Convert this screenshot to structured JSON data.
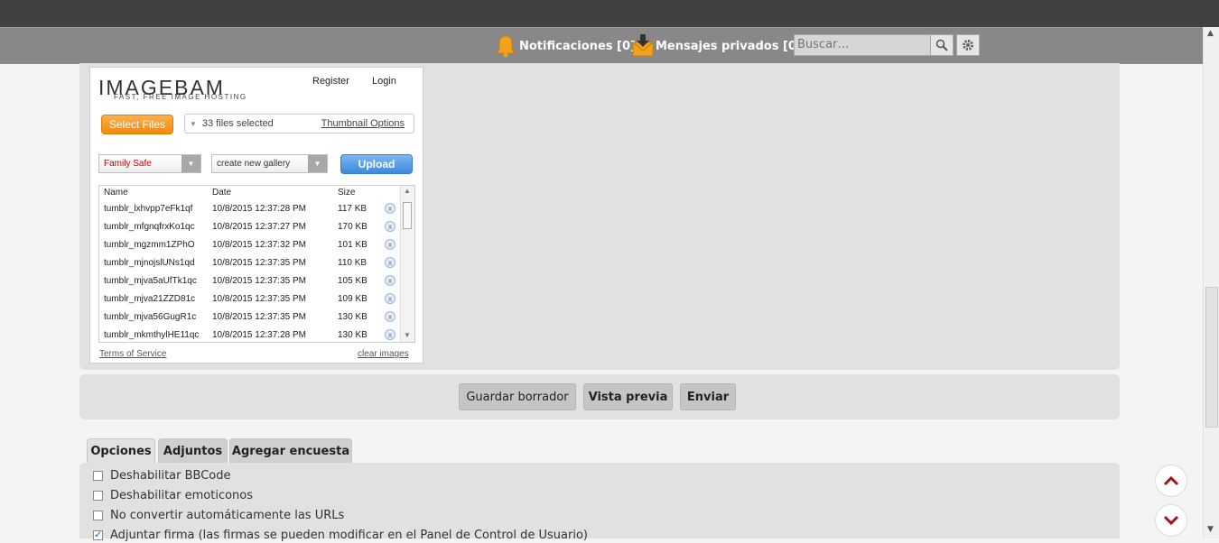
{
  "header": {
    "notifications_label": "Notificaciones [0]",
    "messages_label": "Mensajes privados [0]",
    "search_placeholder": "Buscar…",
    "icons": {
      "notifications": "bell-icon",
      "messages": "inbox-icon",
      "search": "search-icon",
      "advanced": "gear-icon"
    }
  },
  "uploader": {
    "logo": "IMAGEBAM",
    "tagline": "FAST, FREE IMAGE HOSTING",
    "register": "Register",
    "login": "Login",
    "select_files": "Select Files",
    "files_selected": "33 files selected",
    "thumbnail_options": "Thumbnail Options",
    "content_type": "Family Safe",
    "gallery": "create new gallery",
    "upload": "Upload",
    "columns": {
      "name": "Name",
      "date": "Date",
      "size": "Size"
    },
    "files": [
      {
        "name": "tumblr_lxhvpp7eFk1qf",
        "date": "10/8/2015 12:37:28 PM",
        "size": "117 KB"
      },
      {
        "name": "tumblr_mfgnqfrxKo1qc",
        "date": "10/8/2015 12:37:27 PM",
        "size": "170 KB"
      },
      {
        "name": "tumblr_mgzmm1ZPhO",
        "date": "10/8/2015 12:37:32 PM",
        "size": "101 KB"
      },
      {
        "name": "tumblr_mjnojslUNs1qd",
        "date": "10/8/2015 12:37:35 PM",
        "size": "110 KB"
      },
      {
        "name": "tumblr_mjva5aUfTk1qc",
        "date": "10/8/2015 12:37:35 PM",
        "size": "105 KB"
      },
      {
        "name": "tumblr_mjva21ZZD81c",
        "date": "10/8/2015 12:37:35 PM",
        "size": "109 KB"
      },
      {
        "name": "tumblr_mjva56GugR1c",
        "date": "10/8/2015 12:37:35 PM",
        "size": "130 KB"
      },
      {
        "name": "tumblr_mkmthylHE11qc",
        "date": "10/8/2015 12:37:28 PM",
        "size": "130 KB"
      }
    ],
    "remove_glyph": "x",
    "terms": "Terms of Service",
    "clear": "clear images"
  },
  "form_buttons": {
    "save_draft": "Guardar borrador",
    "preview": "Vista previa",
    "submit": "Enviar"
  },
  "tabs": [
    "Opciones",
    "Adjuntos",
    "Agregar encuesta"
  ],
  "options": [
    {
      "label": "Deshabilitar BBCode",
      "checked": false
    },
    {
      "label": "Deshabilitar emoticonos",
      "checked": false
    },
    {
      "label": "No convertir automáticamente las URLs",
      "checked": false
    },
    {
      "label": "Adjuntar firma (las firmas se pueden modificar en el Panel de Control de Usuario)",
      "checked": true
    }
  ],
  "scroll_buttons": {
    "up": "chevron-up-icon",
    "down": "chevron-down-icon"
  },
  "colors": {
    "accent_orange": "#f39a1f",
    "upload_blue": "#4a90e2",
    "chevron_red": "#a01414",
    "family_safe_red": "#c40000"
  }
}
